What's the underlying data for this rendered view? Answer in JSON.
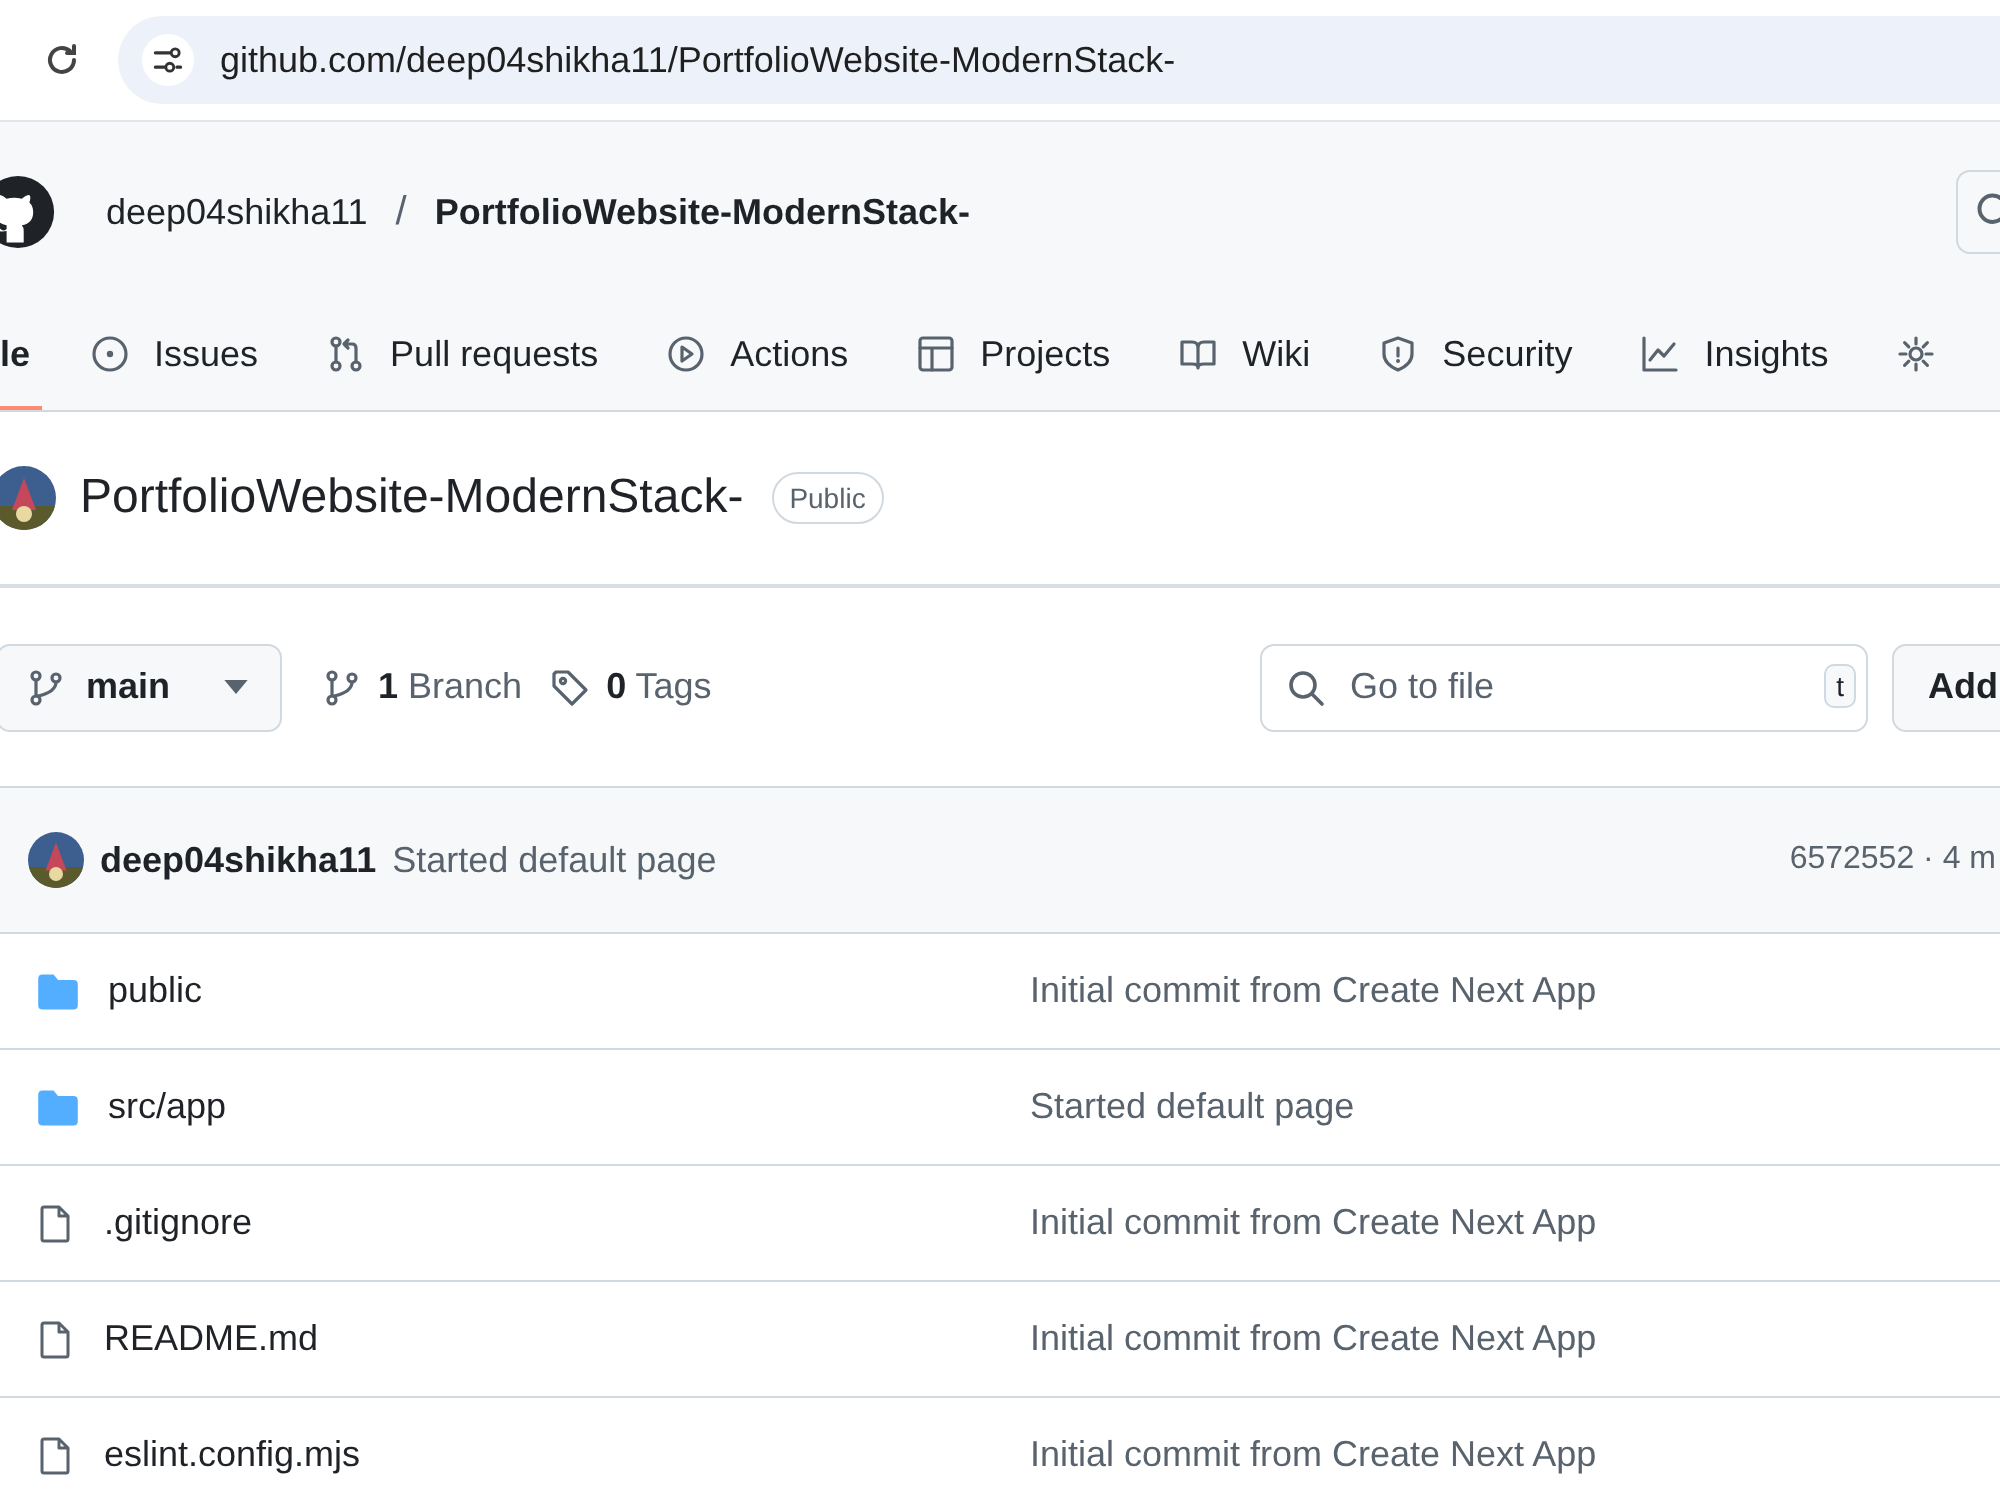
{
  "browser": {
    "url": "github.com/deep04shikha11/PortfolioWebsite-ModernStack-"
  },
  "header": {
    "owner": "deep04shikha11",
    "separator": "/",
    "repo": "PortfolioWebsite-ModernStack-"
  },
  "tabs": [
    {
      "label": "le",
      "kind": "code",
      "selected": true
    },
    {
      "label": "Issues",
      "kind": "issue",
      "selected": false
    },
    {
      "label": "Pull requests",
      "kind": "pull",
      "selected": false
    },
    {
      "label": "Actions",
      "kind": "play",
      "selected": false
    },
    {
      "label": "Projects",
      "kind": "table",
      "selected": false
    },
    {
      "label": "Wiki",
      "kind": "book",
      "selected": false
    },
    {
      "label": "Security",
      "kind": "shield",
      "selected": false
    },
    {
      "label": "Insights",
      "kind": "graph",
      "selected": false
    },
    {
      "kind": "gear",
      "selected": false
    }
  ],
  "repo_title": {
    "name": "PortfolioWebsite-ModernStack-",
    "visibility": "Public"
  },
  "branch_bar": {
    "branch": "main",
    "branch_count": "1",
    "branch_label": "Branch",
    "tag_count": "0",
    "tag_label": "Tags",
    "search": {
      "placeholder": "Go to file",
      "shortcut": "t"
    },
    "add_button": "Add"
  },
  "latest_commit": {
    "author": "deep04shikha11",
    "message": "Started default page",
    "meta": "6572552 · 4 m"
  },
  "files": [
    {
      "name": "public",
      "kind": "folder",
      "commit": "Initial commit from Create Next App"
    },
    {
      "name": "src/app",
      "kind": "folder",
      "commit": "Started default page"
    },
    {
      "name": ".gitignore",
      "kind": "file",
      "commit": "Initial commit from Create Next App"
    },
    {
      "name": "README.md",
      "kind": "file",
      "commit": "Initial commit from Create Next App"
    },
    {
      "name": "eslint.config.mjs",
      "kind": "file",
      "commit": "Initial commit from Create Next App"
    }
  ]
}
